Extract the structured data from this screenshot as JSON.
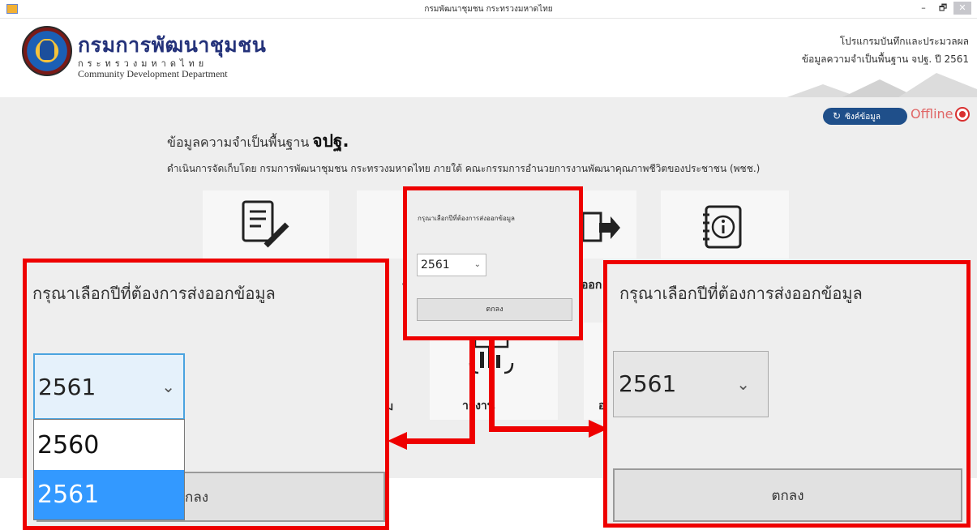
{
  "window": {
    "title": "กรมพัฒนาชุมชน กระทรวงมหาดไทย",
    "minimize": "–",
    "maximize": "🗗",
    "close": "✕"
  },
  "header": {
    "brand_thai": "กรมการพัฒนาชุมชน",
    "brand_ministry": "กระทรวงมหาดไทย",
    "brand_english": "Community Development Department",
    "program_title": "โปรแกรมบันทึกและประมวลผล",
    "program_subtitle": "ข้อมูลความจำเป็นพื้นฐาน จปฐ. ปี 2561"
  },
  "status": {
    "sync_icon": "↻",
    "sync_label": "ซิงค์ข้อมูล",
    "offline_label": "Offline",
    "offline_color": "#d93030"
  },
  "main": {
    "heading_prefix": "ข้อมูลความจำเป็นพื้นฐาน",
    "heading_emphasis": "จปฐ.",
    "description": "ดำเนินการจัดเก็บโดย กรมการพัฒนาชุมชน กระทรวงมหาดไทย ภายใต้ คณะกรรมการอำนวยการงานพัฒนาคุณภาพชีวิตของประชาชน (พชช.)",
    "tile_labels": {
      "import_fragment": "น",
      "export_fragment": "ออก",
      "report": "ายงาน",
      "other_fragment": "อ",
      "left_fragment": "ม"
    }
  },
  "dialog": {
    "title": "กรุณาเลือกปีที่ต้องการส่งออกข้อมูล",
    "selected_year": "2561",
    "ok_label": "ตกลง",
    "options": [
      "2560",
      "2561"
    ]
  },
  "colors": {
    "accent": "#1f4f8a",
    "highlight": "#ee0000",
    "selection": "#3399ff"
  }
}
